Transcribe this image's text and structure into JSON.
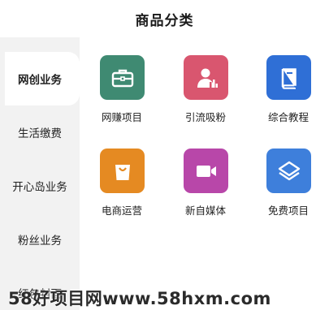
{
  "header": {
    "title": "商品分类"
  },
  "sidebar": {
    "items": [
      {
        "label": "网创业务",
        "active": true
      },
      {
        "label": "生活缴费",
        "active": false
      },
      {
        "label": "开心岛业务",
        "active": false
      },
      {
        "label": "粉丝业务",
        "active": false
      },
      {
        "label": "红包封面",
        "active": false
      }
    ]
  },
  "categories": [
    {
      "label": "网赚项目",
      "icon": "briefcase-icon",
      "color": "#3f8a72"
    },
    {
      "label": "引流吸粉",
      "icon": "user-chart-icon",
      "color": "#d9566f"
    },
    {
      "label": "综合教程",
      "icon": "book-icon",
      "color": "#2f6fd6"
    },
    {
      "label": "电商运营",
      "icon": "shopping-bag-icon",
      "color": "#e58a22"
    },
    {
      "label": "新自媒体",
      "icon": "video-camera-icon",
      "color": "#b847a9"
    },
    {
      "label": "免费项目",
      "icon": "layers-icon",
      "color": "#3e7fdb"
    }
  ],
  "watermark": {
    "text": "58好项目网www.58hxm.com"
  }
}
